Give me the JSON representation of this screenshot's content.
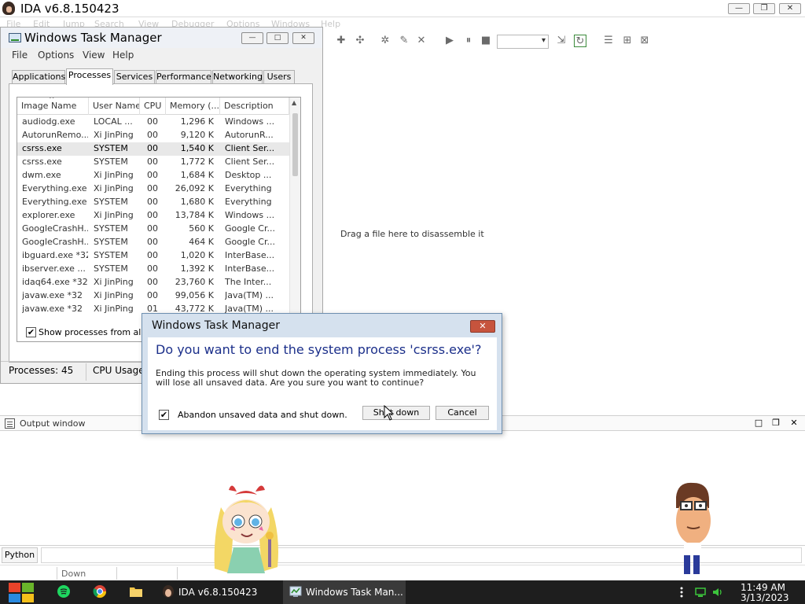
{
  "ida": {
    "title": "IDA v6.8.150423",
    "menu": [
      "File",
      "Edit",
      "Jump",
      "Search",
      "View",
      "Debugger",
      "Options",
      "Windows",
      "Help"
    ],
    "drag_hint": "Drag a file here to disassemble it",
    "window_buttons": {
      "minimize": "—",
      "restore": "❐",
      "close": "✕"
    },
    "output": {
      "title": "Output window",
      "buttons": {
        "maximize": "□",
        "restore": "❐",
        "close": "✕"
      }
    },
    "python_button": "Python",
    "status": "Down"
  },
  "taskmgr": {
    "title": "Windows Task Manager",
    "window_buttons": {
      "minimize": "—",
      "maximize": "□",
      "close": "✕"
    },
    "menu": [
      "File",
      "Options",
      "View",
      "Help"
    ],
    "tabs": [
      "Applications",
      "Processes",
      "Services",
      "Performance",
      "Networking",
      "Users"
    ],
    "active_tab": "Processes",
    "columns": [
      "Image Name",
      "User Name",
      "CPU",
      "Memory (...",
      "Description"
    ],
    "rows": [
      {
        "image": "audiodg.exe",
        "user": "LOCAL ...",
        "cpu": "00",
        "memory": "1,296 K",
        "desc": "Windows ..."
      },
      {
        "image": "AutorunRemo...",
        "user": "Xi JinPing",
        "cpu": "00",
        "memory": "9,120 K",
        "desc": "AutorunR..."
      },
      {
        "image": "csrss.exe",
        "user": "SYSTEM",
        "cpu": "00",
        "memory": "1,540 K",
        "desc": "Client Ser...",
        "selected": true
      },
      {
        "image": "csrss.exe",
        "user": "SYSTEM",
        "cpu": "00",
        "memory": "1,772 K",
        "desc": "Client Ser..."
      },
      {
        "image": "dwm.exe",
        "user": "Xi JinPing",
        "cpu": "00",
        "memory": "1,684 K",
        "desc": "Desktop ..."
      },
      {
        "image": "Everything.exe",
        "user": "Xi JinPing",
        "cpu": "00",
        "memory": "26,092 K",
        "desc": "Everything"
      },
      {
        "image": "Everything.exe",
        "user": "SYSTEM",
        "cpu": "00",
        "memory": "1,680 K",
        "desc": "Everything"
      },
      {
        "image": "explorer.exe",
        "user": "Xi JinPing",
        "cpu": "00",
        "memory": "13,784 K",
        "desc": "Windows ..."
      },
      {
        "image": "GoogleCrashH...",
        "user": "SYSTEM",
        "cpu": "00",
        "memory": "560 K",
        "desc": "Google Cr..."
      },
      {
        "image": "GoogleCrashH...",
        "user": "SYSTEM",
        "cpu": "00",
        "memory": "464 K",
        "desc": "Google Cr..."
      },
      {
        "image": "ibguard.exe *32",
        "user": "SYSTEM",
        "cpu": "00",
        "memory": "1,020 K",
        "desc": "InterBase..."
      },
      {
        "image": "ibserver.exe ...",
        "user": "SYSTEM",
        "cpu": "00",
        "memory": "1,392 K",
        "desc": "InterBase..."
      },
      {
        "image": "idaq64.exe *32",
        "user": "Xi JinPing",
        "cpu": "00",
        "memory": "23,760 K",
        "desc": "The Inter..."
      },
      {
        "image": "javaw.exe *32",
        "user": "Xi JinPing",
        "cpu": "00",
        "memory": "99,056 K",
        "desc": "Java(TM) ..."
      },
      {
        "image": "javaw.exe *32",
        "user": "Xi JinPing",
        "cpu": "01",
        "memory": "43,772 K",
        "desc": "Java(TM) ..."
      }
    ],
    "show_all_label": "Show processes from all use",
    "show_all_checked": true,
    "status": {
      "processes": "Processes: 45",
      "cpu": "CPU Usage"
    }
  },
  "dialog": {
    "title": "Windows Task Manager",
    "close_label": "✕",
    "heading": "Do you want to end the system process 'csrss.exe'?",
    "text": "Ending this process will shut down the operating system immediately.  You will lose all unsaved data.  Are you sure you want to continue?",
    "abandon_label": "Abandon unsaved data and shut down.",
    "abandon_checked": true,
    "shutdown_button": "Shut down",
    "cancel_button": "Cancel"
  },
  "taskbar": {
    "apps": [
      {
        "label": "IDA v6.8.150423",
        "active": false
      },
      {
        "label": "Windows Task Man...",
        "active": true
      }
    ],
    "clock": {
      "time": "11:49 AM",
      "date": "3/13/2023"
    }
  },
  "colors": {
    "dialog_heading": "#1b2f8a",
    "dialog_frame": "#d5e1ee",
    "dialog_close": "#c7543d",
    "taskbar": "#1e1e1e"
  }
}
